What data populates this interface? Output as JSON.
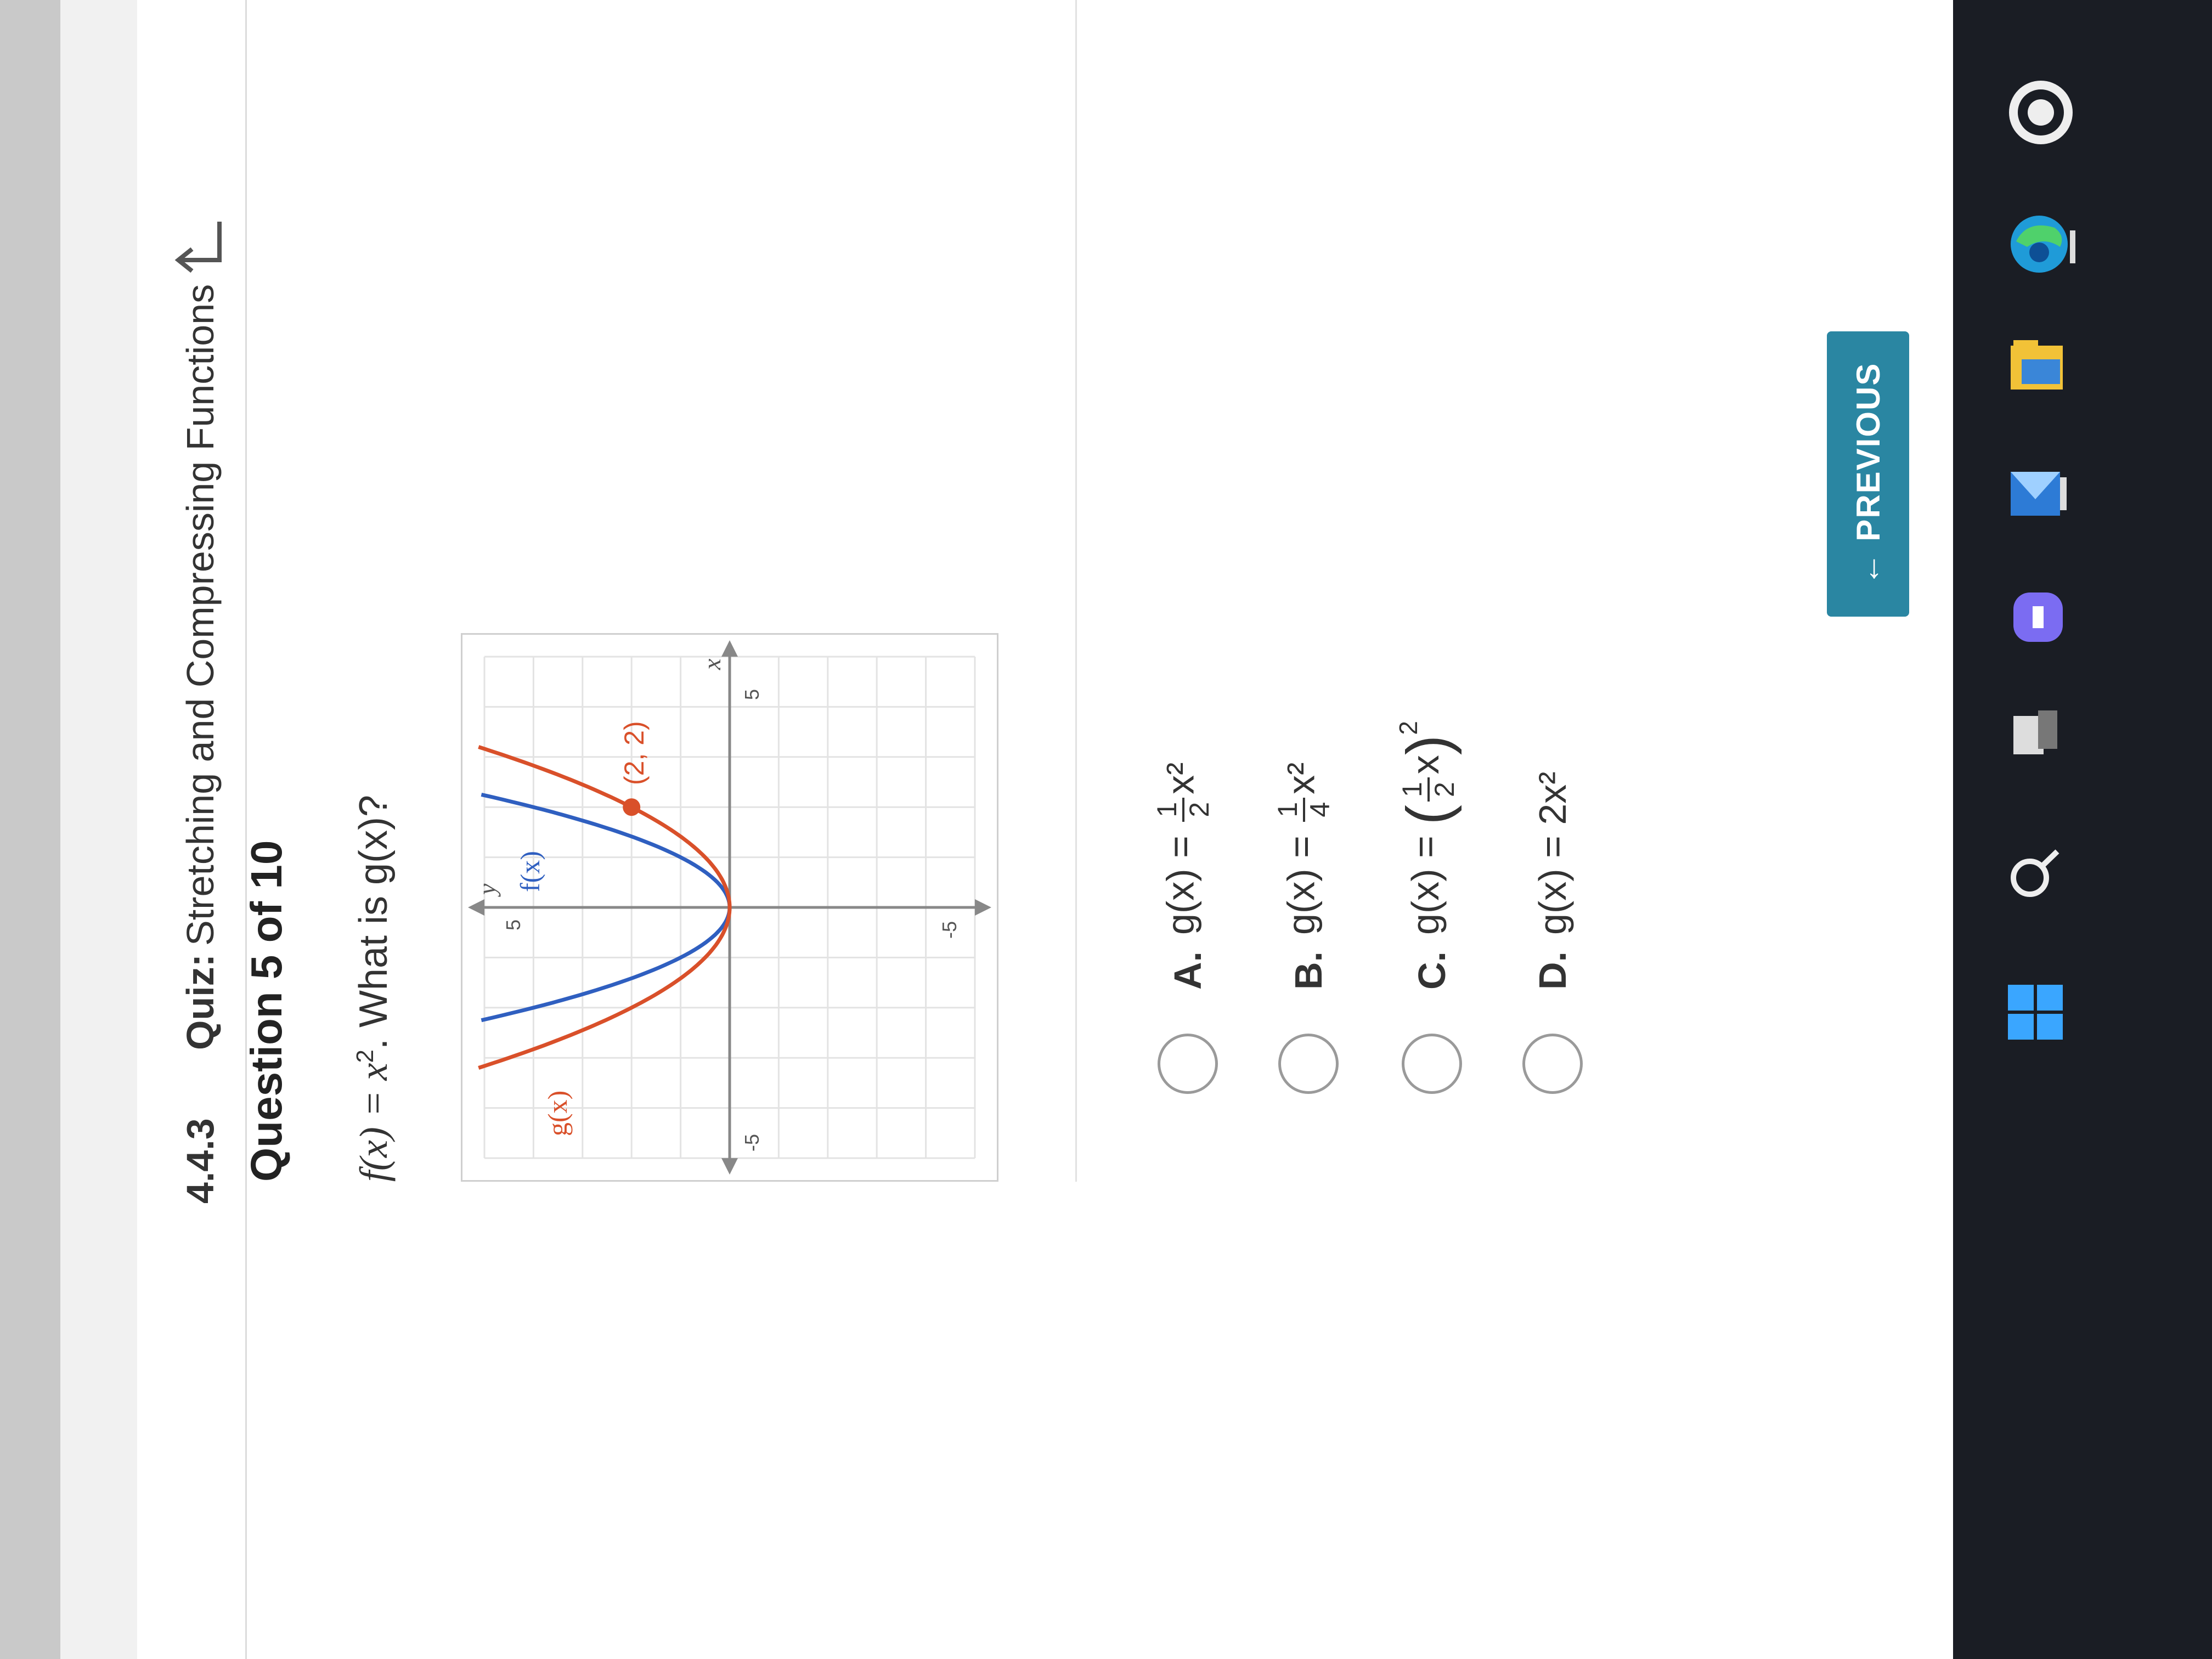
{
  "header": {
    "quiz_code": "4.4.3",
    "quiz_label": "Quiz:",
    "quiz_title": "Stretching and Compressing Functions"
  },
  "question": {
    "number_label": "Question 5 of 10",
    "prompt_f": "f(x) = x",
    "prompt_exp": "2",
    "prompt_rest": ". What is g(x)?"
  },
  "graph": {
    "labels": {
      "y_axis": "y",
      "x_axis": "x",
      "g_label": "g(x)",
      "f_label": "f(x)",
      "point_label": "(2, 2)",
      "tick_neg5_x": "-5",
      "tick_5_x": "5",
      "tick_5_y": "5",
      "tick_neg5_y": "-5"
    },
    "colors": {
      "f": "#2f5fc0",
      "g": "#d9502a"
    },
    "x_range": [
      -5,
      5
    ],
    "y_range": [
      -5,
      5
    ]
  },
  "choices": [
    {
      "letter": "A.",
      "lhs": "g(x) = ",
      "num": "1",
      "den": "2",
      "rhs": "x²"
    },
    {
      "letter": "B.",
      "lhs": "g(x) = ",
      "num": "1",
      "den": "4",
      "rhs": "x²"
    },
    {
      "letter": "C.",
      "lhs": "g(x) = ",
      "num": "1",
      "den": "2",
      "rhs": "x"
    },
    {
      "letter": "D.",
      "lhs": "g(x) = 2x²",
      "num": "",
      "den": "",
      "rhs": ""
    }
  ],
  "choice_c_exp": "2",
  "nav": {
    "previous_label": "← PREVIOUS"
  }
}
